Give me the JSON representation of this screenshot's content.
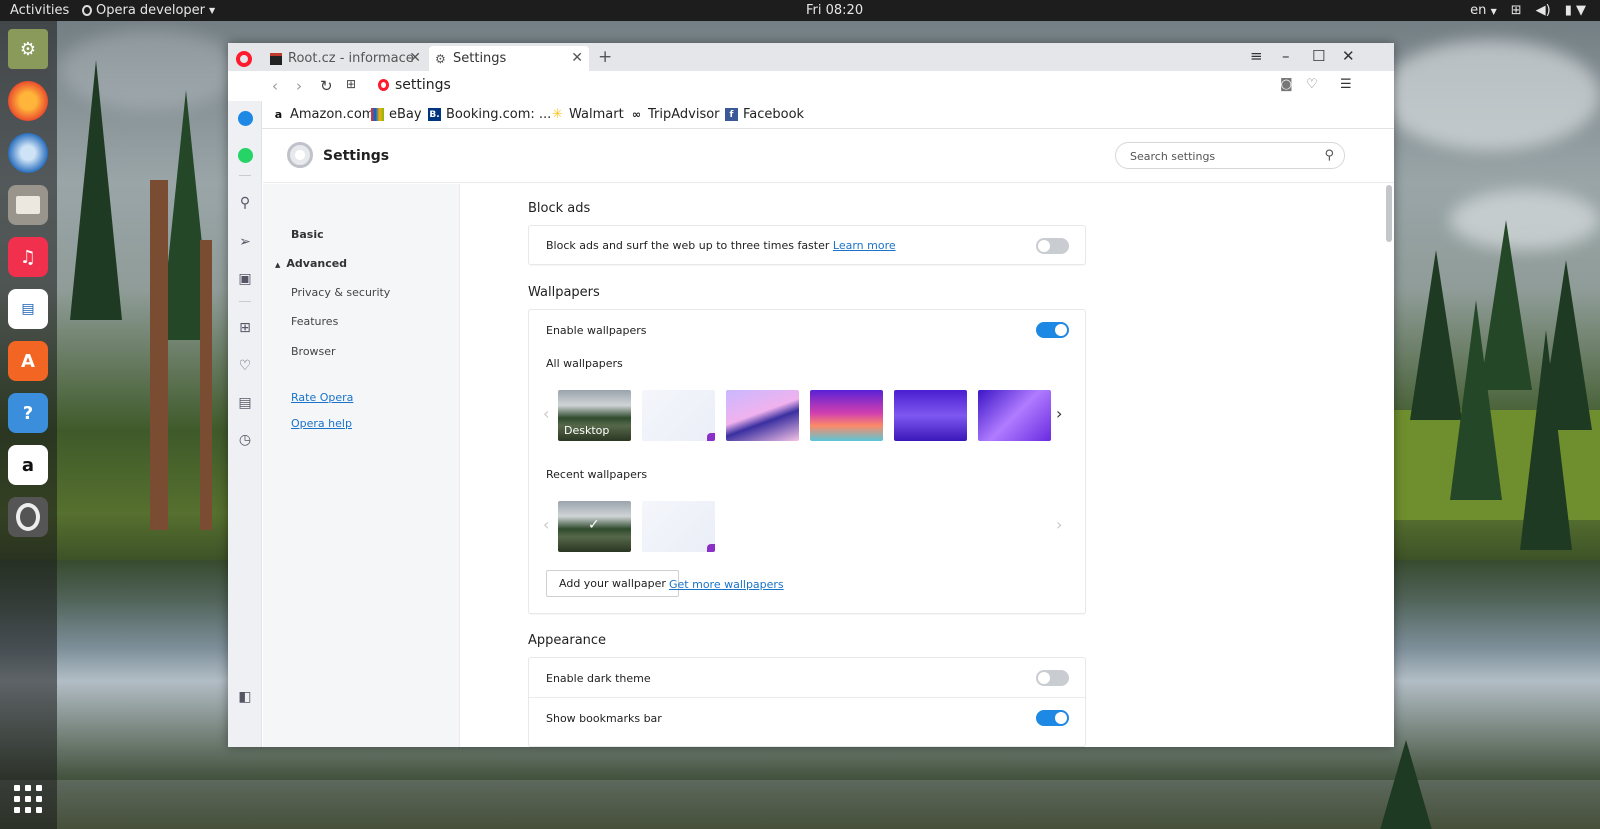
{
  "topbar": {
    "activities": "Activities",
    "app_name": "Opera developer",
    "clock": "Fri 08:20",
    "lang": "en"
  },
  "dock": {
    "items": [
      "app-1",
      "firefox",
      "thunderbird",
      "files",
      "rhythmbox",
      "writer",
      "software",
      "help",
      "amazon",
      "opera"
    ]
  },
  "browser": {
    "tabs": [
      {
        "label": "Root.cz - informace n"
      },
      {
        "label": "Settings"
      }
    ],
    "url": "settings",
    "bookmarks": [
      "Amazon.com",
      "eBay",
      "Booking.com: ...",
      "Walmart",
      "TripAdvisor",
      "Facebook"
    ]
  },
  "settings": {
    "title": "Settings",
    "search_placeholder": "Search settings",
    "nav": {
      "basic": "Basic",
      "advanced": "Advanced",
      "privacy": "Privacy & security",
      "features": "Features",
      "browser": "Browser",
      "rate": "Rate Opera",
      "help": "Opera help"
    },
    "block_ads": {
      "heading": "Block ads",
      "text": "Block ads and surf the web up to three times faster",
      "link": "Learn more",
      "enabled": false
    },
    "wallpapers": {
      "heading": "Wallpapers",
      "enable_label": "Enable wallpapers",
      "enabled": true,
      "all_label": "All wallpapers",
      "desktop_label": "Desktop",
      "recent_label": "Recent wallpapers",
      "add_button": "Add your wallpaper",
      "more_link": "Get more wallpapers"
    },
    "appearance": {
      "heading": "Appearance",
      "dark_label": "Enable dark theme",
      "dark_enabled": false,
      "bookmarks_label": "Show bookmarks bar",
      "bookmarks_enabled": true
    }
  },
  "colors": {
    "accent": "#1e88e5",
    "opera_red": "#ff1b2d",
    "link": "#1a73c9"
  }
}
